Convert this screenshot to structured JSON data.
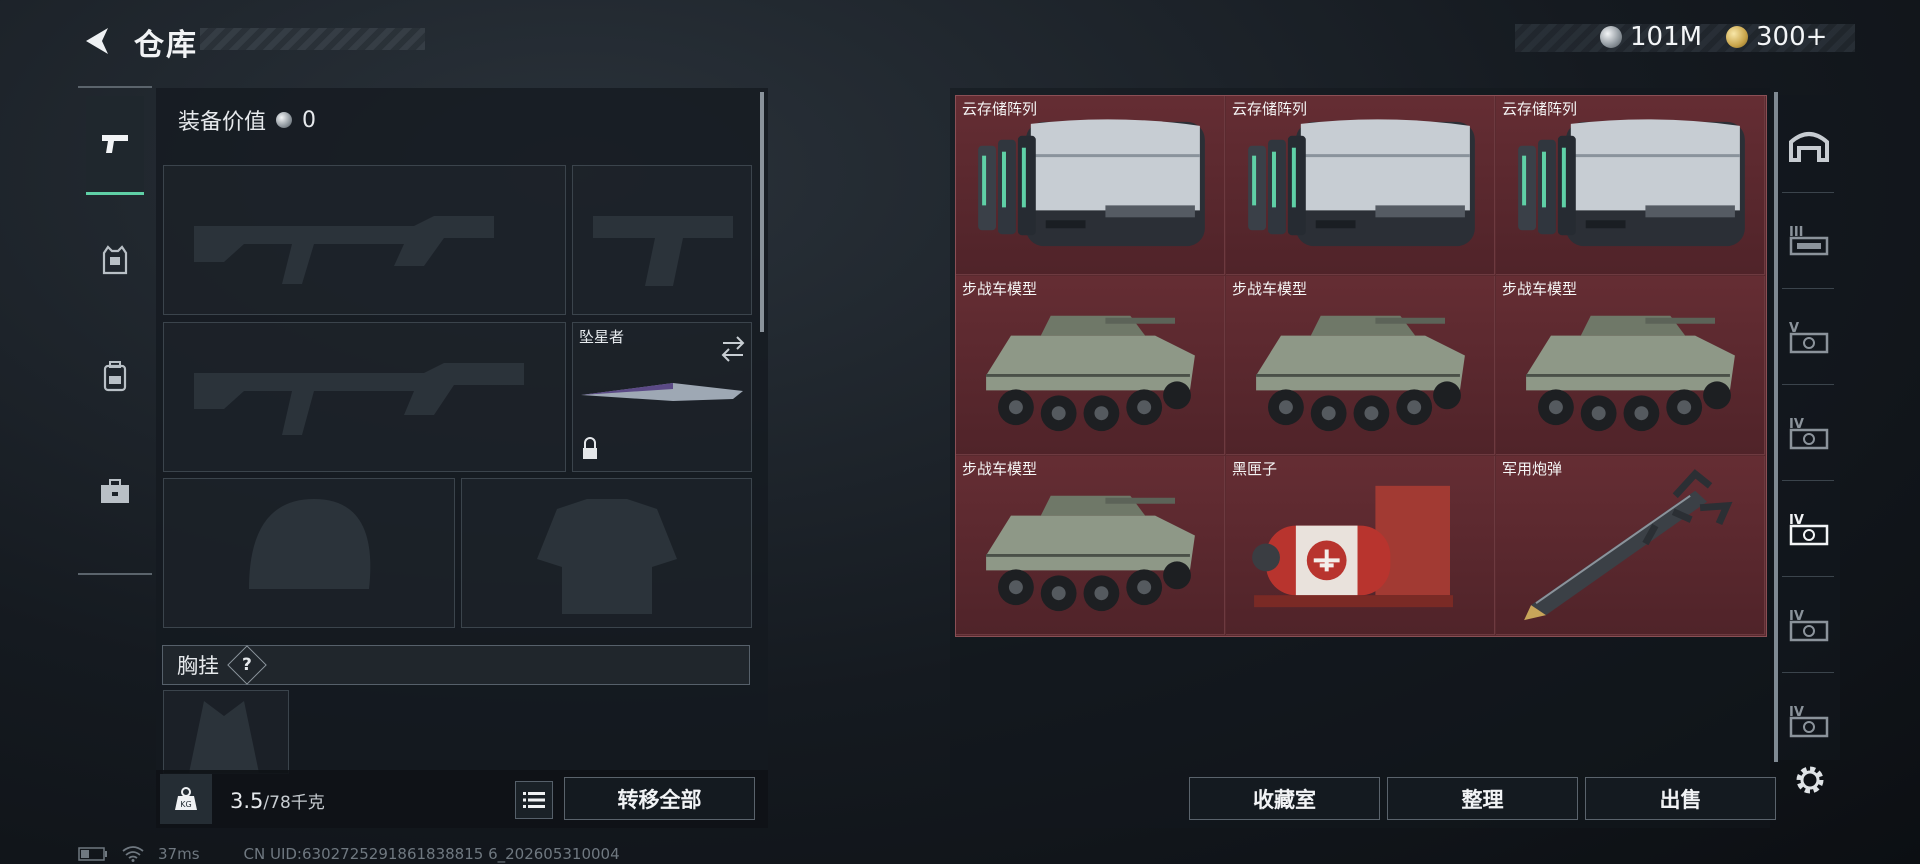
{
  "header": {
    "title": "仓库",
    "currency_silver": "101M",
    "currency_gold": "300+"
  },
  "left_tabs": [
    {
      "name": "weapon-tab",
      "icon": "pistol-icon",
      "active": true
    },
    {
      "name": "armor-tab",
      "icon": "vest-icon",
      "active": false
    },
    {
      "name": "backpack-tab",
      "icon": "backpack-icon",
      "active": false
    },
    {
      "name": "case-tab",
      "icon": "toolbox-icon",
      "active": false
    }
  ],
  "loadout": {
    "equip_value_label": "装备价值",
    "equip_value": "0",
    "melee_slot_label": "坠星者",
    "chest_rig_label": "胸挂",
    "chest_rig_hint": "?",
    "weight_current": "3.5",
    "weight_max": "/78千克",
    "transfer_all_label": "转移全部"
  },
  "storage": {
    "items": [
      {
        "name": "云存储阵列",
        "kind": "server"
      },
      {
        "name": "云存储阵列",
        "kind": "server"
      },
      {
        "name": "云存储阵列",
        "kind": "server"
      },
      {
        "name": "步战车模型",
        "kind": "ifv"
      },
      {
        "name": "步战车模型",
        "kind": "ifv"
      },
      {
        "name": "步战车模型",
        "kind": "ifv"
      },
      {
        "name": "步战车模型",
        "kind": "ifv"
      },
      {
        "name": "黑匣子",
        "kind": "blackbox"
      },
      {
        "name": "军用炮弹",
        "kind": "missile"
      }
    ],
    "collection_label": "收藏室",
    "sort_label": "整理",
    "sell_label": "出售"
  },
  "right_rail": [
    "bunker-icon",
    "tier-iii-case-icon",
    "tier-v-case-icon",
    "tier-iv-case-icon",
    "tier-iv-case-active-icon",
    "tier-iv-case-icon",
    "tier-iv-case-icon"
  ],
  "status_bar": {
    "ping": "37ms",
    "uid": "CN UID:6302725291861838815 6_202605310004"
  },
  "colors": {
    "accent": "#5fd0a6",
    "storage_bg": "#5a2a2f",
    "panel_bg": "#141a20"
  }
}
